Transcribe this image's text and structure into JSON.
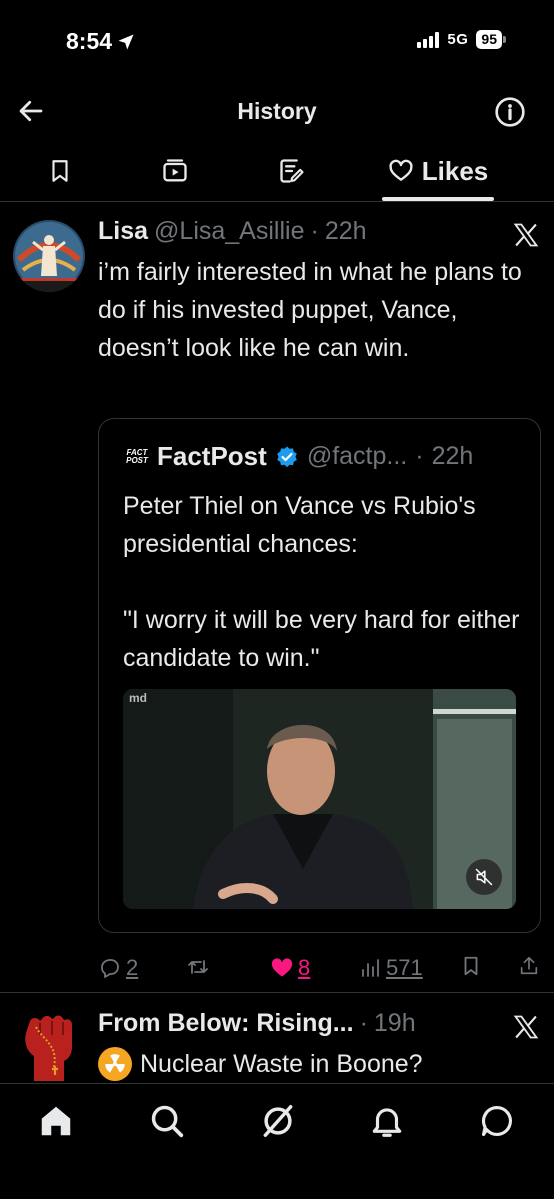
{
  "status_bar": {
    "time": "8:54",
    "network": "5G",
    "battery": "95"
  },
  "header": {
    "title": "History"
  },
  "tabs": [
    {
      "name": "bookmarks",
      "label": ""
    },
    {
      "name": "videos",
      "label": ""
    },
    {
      "name": "articles",
      "label": ""
    },
    {
      "name": "likes",
      "label": "Likes"
    }
  ],
  "tweet": {
    "author_name": "Lisa",
    "author_handle": "@Lisa_Asillie",
    "separator": "·",
    "time": "22h",
    "text": "i’m fairly interested in what he plans to do if his invested puppet, Vance, doesn’t look like he can win.",
    "quote": {
      "logo_text_top": "FACT",
      "logo_text_bottom": "POST",
      "author_name": "FactPost",
      "author_handle": "@factp...",
      "separator": "·",
      "time": "22h",
      "text": "Peter Thiel on Vance vs Rubio's presidential chances:\n\n\"I worry it will be very hard for either candidate to win.\"",
      "media_logo": "md"
    },
    "actions": {
      "replies": "2",
      "reposts": "",
      "likes": "8",
      "views": "571"
    }
  },
  "tweet2": {
    "author_name": "From Below: Rising...",
    "separator": "·",
    "time": "19h",
    "text": "Nuclear Waste in Boone?"
  },
  "colors": {
    "background": "#000000",
    "text": "#e7e9ea",
    "muted": "#71767b",
    "like": "#f91880",
    "verified": "#1d9bf0",
    "divider": "#2f3336"
  }
}
